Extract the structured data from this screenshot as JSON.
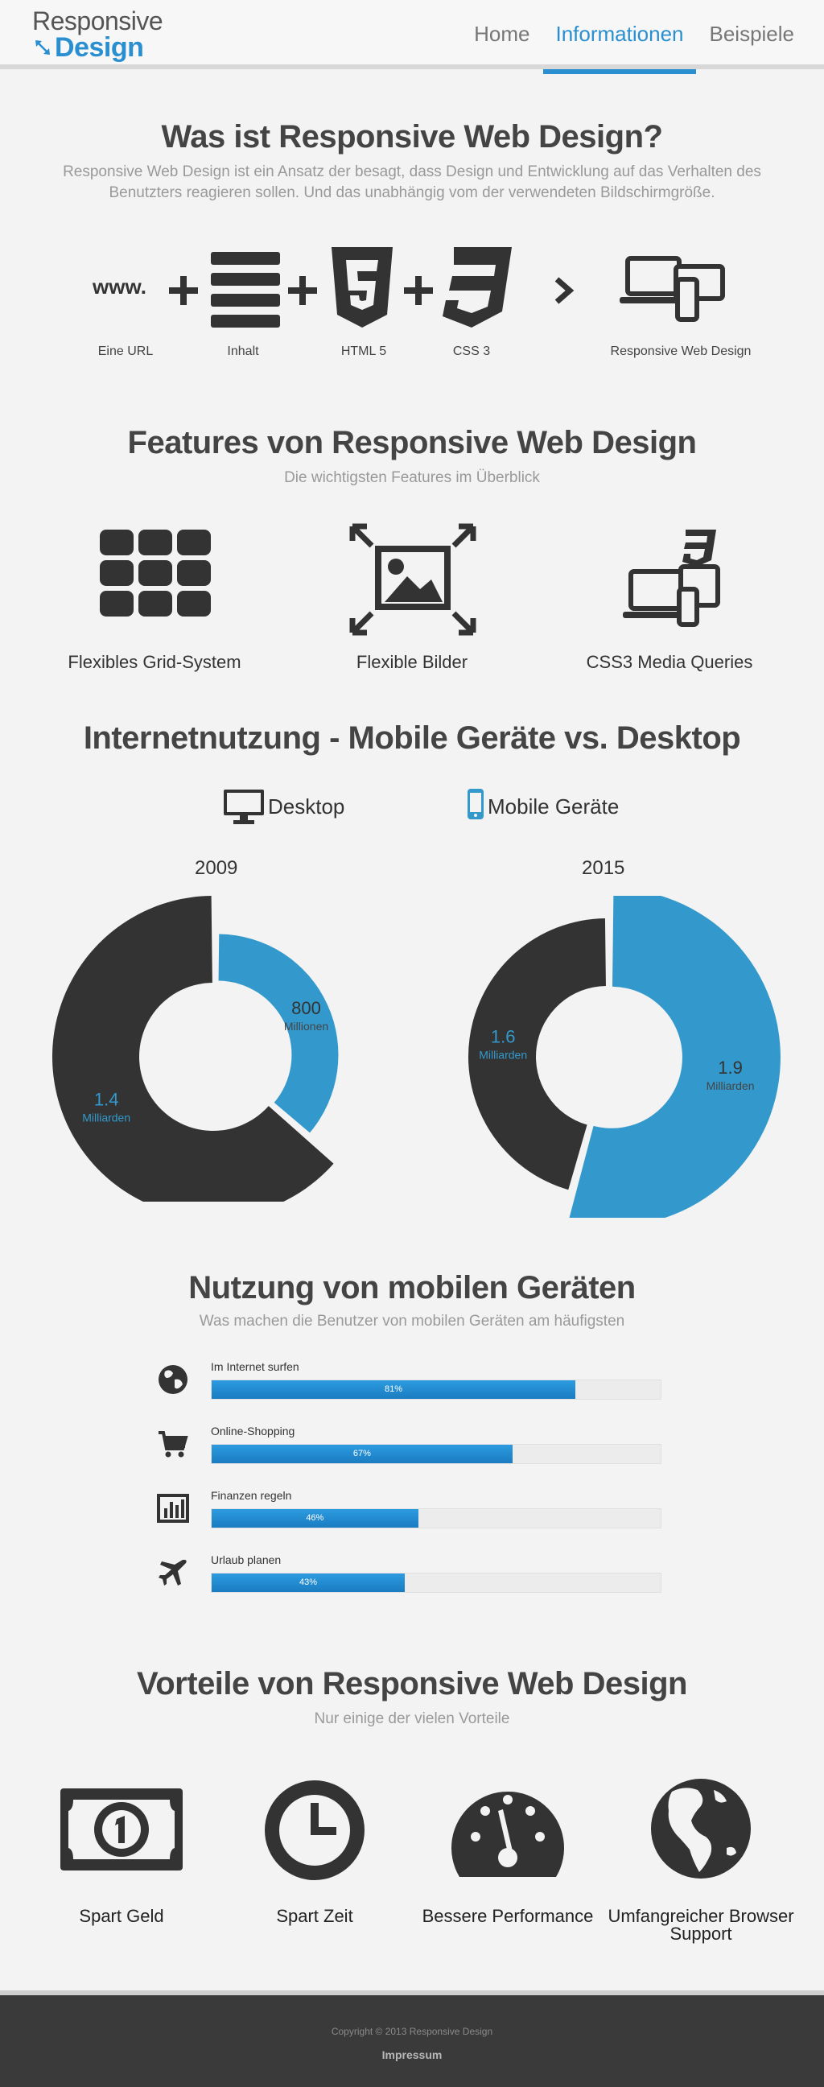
{
  "header": {
    "logo_top": "Responsive",
    "logo_bottom": "Design",
    "nav": [
      {
        "label": "Home",
        "active": false
      },
      {
        "label": "Informationen",
        "active": true
      },
      {
        "label": "Beispiele",
        "active": false
      }
    ]
  },
  "intro": {
    "title": "Was ist Responsive Web Design?",
    "text": "Responsive Web Design ist ein Ansatz der besagt, dass Design und Entwicklung auf das Verhalten des Benutzters reagieren sollen. Und das unabhängig vom der verwendeten Bildschirmgröße.",
    "equation": {
      "www": "www.",
      "labels": [
        "Eine URL",
        "Inhalt",
        "HTML 5",
        "CSS 3",
        "Responsive Web Design"
      ]
    }
  },
  "features": {
    "title": "Features von Responsive Web Design",
    "subtitle": "Die wichtigsten Features im Überblick",
    "items": [
      {
        "label": "Flexibles Grid-System",
        "icon": "grid-icon"
      },
      {
        "label": "Flexible Bilder",
        "icon": "image-expand-icon"
      },
      {
        "label": "CSS3 Media Queries",
        "icon": "devices-css3-icon"
      }
    ]
  },
  "usage": {
    "title": "Internetnutzung - Mobile Geräte vs. Desktop",
    "legend": {
      "desktop": "Desktop",
      "mobile": "Mobile Geräte"
    },
    "colors": {
      "desktop": "#333333",
      "mobile": "#3399cc"
    }
  },
  "chart_data": [
    {
      "type": "pie",
      "title": "2009",
      "categories": [
        "Mobile Geräte",
        "Desktop"
      ],
      "values": [
        0.8,
        1.4
      ],
      "unit": "billions",
      "labels": [
        {
          "value": "800",
          "unit": "Millionen"
        },
        {
          "value": "1.4",
          "unit": "Milliarden"
        }
      ]
    },
    {
      "type": "pie",
      "title": "2015",
      "categories": [
        "Mobile Geräte",
        "Desktop"
      ],
      "values": [
        1.9,
        1.6
      ],
      "unit": "billions",
      "labels": [
        {
          "value": "1.9",
          "unit": "Milliarden"
        },
        {
          "value": "1.6",
          "unit": "Milliarden"
        }
      ]
    },
    {
      "type": "bar",
      "title": "Nutzung von mobilen Geräten",
      "categories": [
        "Im Internet surfen",
        "Online-Shopping",
        "Finanzen regeln",
        "Urlaub planen"
      ],
      "values": [
        81,
        67,
        46,
        43
      ],
      "value_labels": [
        "81%",
        "67%",
        "46%",
        "43%"
      ],
      "ylim": [
        0,
        100
      ]
    }
  ],
  "mobile": {
    "title": "Nutzung von mobilen Geräten",
    "subtitle": "Was machen die Benutzer von mobilen Geräten am häufigsten",
    "icons": [
      "globe-icon",
      "cart-icon",
      "chart-icon",
      "plane-icon"
    ]
  },
  "advantages": {
    "title": "Vorteile von Responsive Web Design",
    "subtitle": "Nur einige der vielen Vorteile",
    "items": [
      {
        "label": "Spart Geld",
        "icon": "money-icon"
      },
      {
        "label": "Spart Zeit",
        "icon": "clock-icon"
      },
      {
        "label": "Bessere Performance",
        "icon": "speedometer-icon"
      },
      {
        "label": "Umfangreicher Browser Support",
        "icon": "globe-icon"
      }
    ]
  },
  "footer": {
    "copyright": "Copyright © 2013 Responsive Design",
    "impressum": "Impressum"
  }
}
